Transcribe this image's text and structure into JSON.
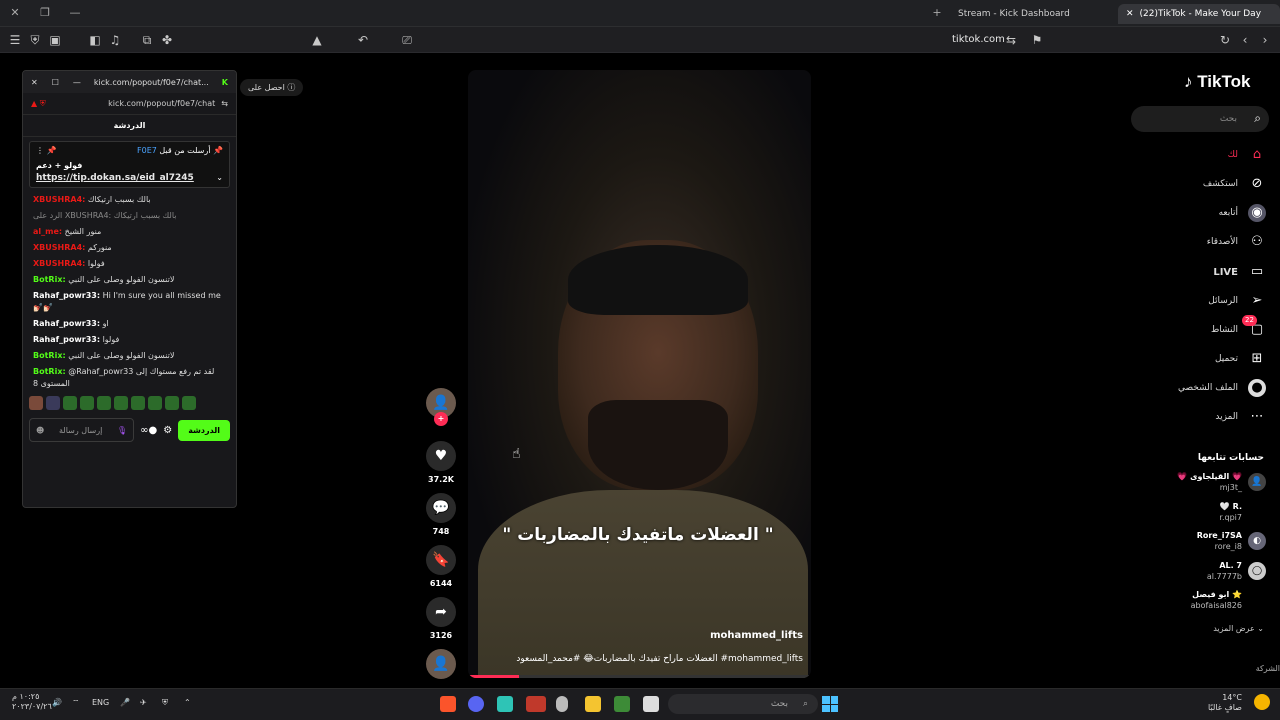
{
  "browser": {
    "tabs": [
      {
        "label": "Stream - Kick Dashboard"
      },
      {
        "label": "(22)TikTok - Make Your Day"
      }
    ],
    "url": "tiktok.com",
    "extension_tip": "احصل على"
  },
  "tiktok": {
    "logo": "TikTok",
    "search_placeholder": "بحث",
    "nav": [
      {
        "label": "لك",
        "icon": "home-icon"
      },
      {
        "label": "استكشف",
        "icon": "compass-icon"
      },
      {
        "label": "أتابعه",
        "icon": "following-avatar-icon"
      },
      {
        "label": "الأصدقاء",
        "icon": "friends-icon"
      },
      {
        "label": "LIVE",
        "icon": "live-icon"
      },
      {
        "label": "الرسائل",
        "icon": "send-icon"
      },
      {
        "label": "النشاط",
        "icon": "inbox-icon",
        "badge": "22"
      },
      {
        "label": "تحميل",
        "icon": "upload-icon"
      },
      {
        "label": "الملف الشخصي",
        "icon": "profile-icon"
      },
      {
        "label": "المزيد",
        "icon": "more-icon"
      }
    ],
    "following_title": "حسابات تتابعها",
    "following": [
      {
        "name": "💗 القيلجاوى 💗",
        "handle": "mj3t_"
      },
      {
        "name": "🤍 R.",
        "handle": "r.qpi7"
      },
      {
        "name": "Rore_i7SA",
        "handle": "rore_i8"
      },
      {
        "name": "AL. 7",
        "handle": "al.7777b"
      },
      {
        "name": "ابو فيصل ⭐",
        "handle": "abofaisal826"
      }
    ],
    "see_more": "عرض المزيد",
    "cut_label": "الشركة"
  },
  "video": {
    "caption": "\" العضلات ماتفيدك بالمضاربات \"",
    "username": "mohammed_lifts",
    "description": "العضلات ماراح تفيدك بالمضاربات😂 #محمد_المسعود #mohammed_lifts",
    "likes": "37.2K",
    "comments": "748",
    "saves": "6144",
    "shares": "3126",
    "progress": 0.15
  },
  "popup": {
    "title_bar": "kick.com/popout/f0e7/chat...",
    "url": "kick.com/popout/f0e7/chat",
    "header": "الدردشة",
    "pinned_by": "أرسلت من قبل",
    "pinned_user": "F0E7",
    "pinned_text": "فولو + دعم",
    "pinned_link": "https://tip.dokan.sa/eid_al7245",
    "messages": [
      {
        "user": "XBUSHRA4:",
        "text": "بالك بسبب ارتيكاك",
        "color": "red"
      },
      {
        "user": "",
        "text": "الرد على XBUSHRA4: بالك بسبب ارتيكاك",
        "color": "grey"
      },
      {
        "user": "al_me:",
        "text": "منور الشيخ",
        "color": "red"
      },
      {
        "user": "XBUSHRA4:",
        "text": "منورکم",
        "color": "red"
      },
      {
        "user": "XBUSHRA4:",
        "text": "فولوا",
        "color": "red"
      },
      {
        "user": "BotRix:",
        "text": "لاتنسون الفولو وصلى على النبي",
        "color": "green"
      },
      {
        "user": "Rahaf_powr33:",
        "text": "Hi I'm sure you all missed me 💅🏻💅🏻",
        "color": "white"
      },
      {
        "user": "Rahaf_powr33:",
        "text": "او",
        "color": "white"
      },
      {
        "user": "Rahaf_powr33:",
        "text": "فولوا",
        "color": "white"
      },
      {
        "user": "BotRix:",
        "text": "لاتنسون الفولو وصلى على النبي",
        "color": "green"
      },
      {
        "user": "BotRix:",
        "text": "@Rahaf_powr33 لقد تم رفع مستواك إلى المستوى 8",
        "color": "green"
      }
    ],
    "input_placeholder": "إرسال رسالة",
    "send_label": "الدردشة"
  },
  "taskbar": {
    "search_placeholder": "بحث",
    "lang": "ENG",
    "time": "١٠:٢٥ م",
    "date": "٢٠٢٣/٠٧/٢٦",
    "weather_temp": "14°C",
    "weather_desc": "صافٍ غالبًا"
  }
}
